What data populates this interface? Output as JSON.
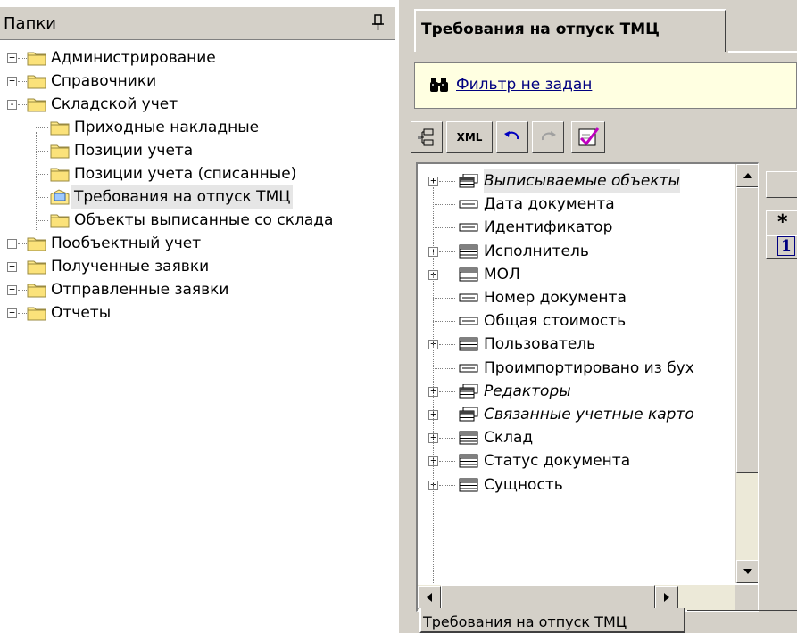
{
  "folders_panel": {
    "title": "Папки",
    "items": [
      {
        "label": "Администрирование",
        "expander": "+"
      },
      {
        "label": "Справочники",
        "expander": "+"
      },
      {
        "label": "Складской учет",
        "expander": "−"
      },
      {
        "label": "Приходные накладные"
      },
      {
        "label": "Позиции учета"
      },
      {
        "label": "Позиции учета (списанные)"
      },
      {
        "label": "Требования на отпуск ТМЦ",
        "selected": true
      },
      {
        "label": "Объекты выписанные со склада"
      },
      {
        "label": "Пообъектный учет",
        "expander": "+"
      },
      {
        "label": "Полученные заявки",
        "expander": "+"
      },
      {
        "label": "Отправленные заявки",
        "expander": "+"
      },
      {
        "label": "Отчеты",
        "expander": "+"
      }
    ]
  },
  "main": {
    "tab_label": "Требования на отпуск ТМЦ",
    "filter_text": "Фильтр не задан",
    "toolbar": {
      "xml_label": "XML"
    },
    "fields": [
      {
        "label": "Выписываемые объекты",
        "italic": true,
        "expander": "+",
        "icon": "table-multi-icon"
      },
      {
        "label": "Дата документа",
        "icon": "field-icon"
      },
      {
        "label": "Идентификатор",
        "icon": "field-icon"
      },
      {
        "label": "Исполнитель",
        "expander": "+",
        "icon": "table-icon"
      },
      {
        "label": "МОЛ",
        "expander": "+",
        "icon": "table-icon"
      },
      {
        "label": "Номер документа",
        "icon": "field-icon"
      },
      {
        "label": "Общая стоимость",
        "icon": "field-icon"
      },
      {
        "label": "Пользователь",
        "expander": "+",
        "icon": "table-icon"
      },
      {
        "label": "Проимпортировано из бух",
        "icon": "field-icon"
      },
      {
        "label": "Редакторы",
        "italic": true,
        "expander": "+",
        "icon": "table-multi-icon"
      },
      {
        "label": "Связанные учетные карто",
        "italic": true,
        "expander": "+",
        "icon": "table-multi-icon"
      },
      {
        "label": "Склад",
        "expander": "+",
        "icon": "table-icon"
      },
      {
        "label": "Статус документа",
        "expander": "+",
        "icon": "table-icon"
      },
      {
        "label": "Сущность",
        "expander": "+",
        "icon": "table-icon"
      }
    ],
    "side_buttons": [
      "",
      "*",
      "1"
    ],
    "bottom_tab_label": "Требования на отпуск ТМЦ"
  }
}
